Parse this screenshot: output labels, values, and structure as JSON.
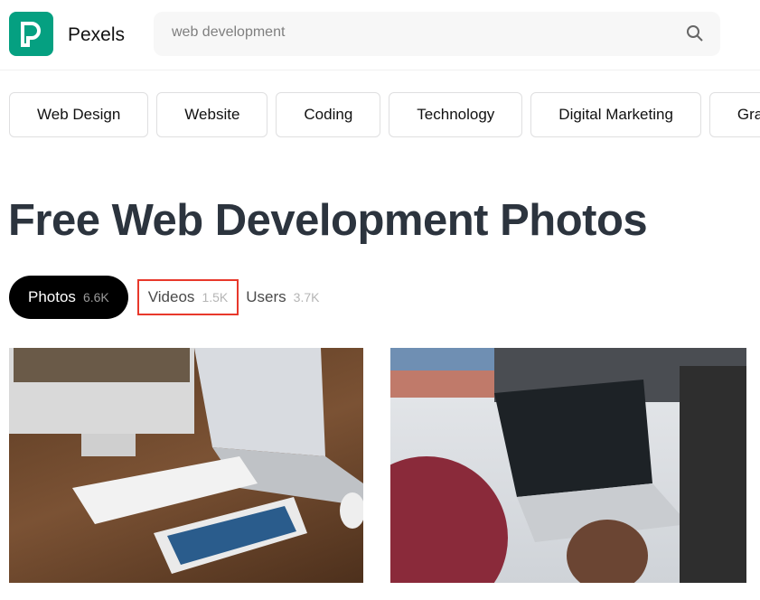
{
  "header": {
    "brand": "Pexels",
    "search": {
      "value": "web development",
      "placeholder": "web development"
    },
    "logo_color": "#05a081"
  },
  "tags": [
    "Web Design",
    "Website",
    "Coding",
    "Technology",
    "Digital Marketing",
    "Gra"
  ],
  "page_title": "Free Web Development Photos",
  "tabs": [
    {
      "label": "Photos",
      "count": "6.6K"
    },
    {
      "label": "Videos",
      "count": "1.5K"
    },
    {
      "label": "Users",
      "count": "3.7K"
    }
  ],
  "highlight_color": "#e8382b"
}
